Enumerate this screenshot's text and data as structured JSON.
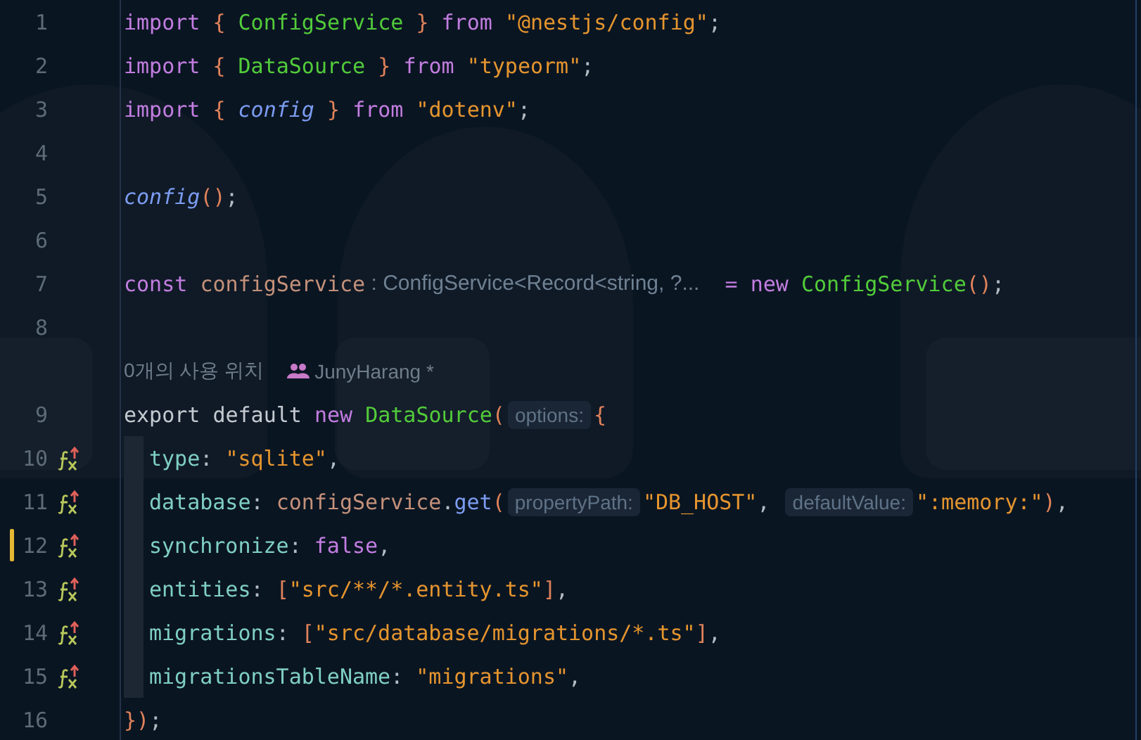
{
  "editor": {
    "lines": [
      {
        "number": "1",
        "modified": false,
        "override_marker": false,
        "indent_guide": false,
        "tokens": [
          {
            "text": "import ",
            "kind": "keyword"
          },
          {
            "text": "{ ",
            "kind": "brace"
          },
          {
            "text": "ConfigService",
            "kind": "class"
          },
          {
            "text": " } ",
            "kind": "brace"
          },
          {
            "text": "from ",
            "kind": "keyword"
          },
          {
            "text": "\"@nestjs/config\"",
            "kind": "string"
          },
          {
            "text": ";",
            "kind": "punct"
          }
        ]
      },
      {
        "number": "2",
        "modified": false,
        "override_marker": false,
        "indent_guide": false,
        "tokens": [
          {
            "text": "import ",
            "kind": "keyword"
          },
          {
            "text": "{ ",
            "kind": "brace"
          },
          {
            "text": "DataSource",
            "kind": "class"
          },
          {
            "text": " } ",
            "kind": "brace"
          },
          {
            "text": "from ",
            "kind": "keyword"
          },
          {
            "text": "\"typeorm\"",
            "kind": "string"
          },
          {
            "text": ";",
            "kind": "punct"
          }
        ]
      },
      {
        "number": "3",
        "modified": false,
        "override_marker": false,
        "indent_guide": false,
        "tokens": [
          {
            "text": "import ",
            "kind": "keyword"
          },
          {
            "text": "{ ",
            "kind": "brace"
          },
          {
            "text": "config",
            "kind": "function"
          },
          {
            "text": " } ",
            "kind": "brace"
          },
          {
            "text": "from ",
            "kind": "keyword"
          },
          {
            "text": "\"dotenv\"",
            "kind": "string"
          },
          {
            "text": ";",
            "kind": "punct"
          }
        ]
      },
      {
        "number": "4",
        "modified": false,
        "override_marker": false,
        "indent_guide": false
      },
      {
        "number": "5",
        "modified": false,
        "override_marker": false,
        "indent_guide": false,
        "tokens": [
          {
            "text": "config",
            "kind": "function"
          },
          {
            "text": "()",
            "kind": "brace"
          },
          {
            "text": ";",
            "kind": "punct"
          }
        ]
      },
      {
        "number": "6",
        "modified": false,
        "override_marker": false,
        "indent_guide": false
      },
      {
        "number": "7",
        "modified": false,
        "override_marker": false,
        "indent_guide": false,
        "tokens": [
          {
            "text": "const ",
            "kind": "keyword"
          },
          {
            "text": "configService",
            "kind": "variable"
          },
          {
            "text": " : ConfigService<Record<string, ?...",
            "kind": "type_hint"
          },
          {
            "text": "  = ",
            "kind": "keyword"
          },
          {
            "text": "new ",
            "kind": "keyword"
          },
          {
            "text": "ConfigService",
            "kind": "class"
          },
          {
            "text": "()",
            "kind": "brace"
          },
          {
            "text": ";",
            "kind": "punct"
          }
        ]
      },
      {
        "number": "8",
        "modified": false,
        "override_marker": false,
        "indent_guide": false,
        "code_lens": {
          "usages": "0개의 사용 위치",
          "author": "JunyHarang *"
        }
      },
      {
        "number": "9",
        "modified": false,
        "override_marker": false,
        "indent_guide": false,
        "tokens": [
          {
            "text": "export default ",
            "kind": "plain"
          },
          {
            "text": "new ",
            "kind": "keyword"
          },
          {
            "text": "DataSource",
            "kind": "class"
          },
          {
            "text": "(",
            "kind": "brace"
          },
          {
            "text": "options:",
            "kind": "hint"
          },
          {
            "text": "{",
            "kind": "brace"
          }
        ]
      },
      {
        "number": "10",
        "modified": false,
        "override_marker": true,
        "indent_guide": true,
        "tokens": [
          {
            "text": "type",
            "kind": "property"
          },
          {
            "text": ": ",
            "kind": "punct"
          },
          {
            "text": "\"sqlite\"",
            "kind": "string"
          },
          {
            "text": ",",
            "kind": "punct"
          }
        ]
      },
      {
        "number": "11",
        "modified": false,
        "override_marker": true,
        "indent_guide": true,
        "tokens": [
          {
            "text": "database",
            "kind": "property"
          },
          {
            "text": ": ",
            "kind": "punct"
          },
          {
            "text": "configService",
            "kind": "variable"
          },
          {
            "text": ".",
            "kind": "punct"
          },
          {
            "text": "get",
            "kind": "method"
          },
          {
            "text": "(",
            "kind": "brace"
          },
          {
            "text": "propertyPath:",
            "kind": "hint"
          },
          {
            "text": "\"DB_HOST\"",
            "kind": "string"
          },
          {
            "text": ", ",
            "kind": "punct"
          },
          {
            "text": "defaultValue:",
            "kind": "hint"
          },
          {
            "text": "\":memory:\"",
            "kind": "string"
          },
          {
            "text": ")",
            "kind": "brace"
          },
          {
            "text": ",",
            "kind": "punct"
          }
        ]
      },
      {
        "number": "12",
        "modified": true,
        "override_marker": true,
        "indent_guide": true,
        "tokens": [
          {
            "text": "synchronize",
            "kind": "property"
          },
          {
            "text": ": ",
            "kind": "punct"
          },
          {
            "text": "false",
            "kind": "keyword"
          },
          {
            "text": ",",
            "kind": "punct"
          }
        ]
      },
      {
        "number": "13",
        "modified": false,
        "override_marker": true,
        "indent_guide": true,
        "tokens": [
          {
            "text": "entities",
            "kind": "property"
          },
          {
            "text": ": ",
            "kind": "punct"
          },
          {
            "text": "[",
            "kind": "brace"
          },
          {
            "text": "\"src/**/*.entity.ts\"",
            "kind": "string"
          },
          {
            "text": "]",
            "kind": "brace"
          },
          {
            "text": ",",
            "kind": "punct"
          }
        ]
      },
      {
        "number": "14",
        "modified": false,
        "override_marker": true,
        "indent_guide": true,
        "tokens": [
          {
            "text": "migrations",
            "kind": "property"
          },
          {
            "text": ": ",
            "kind": "punct"
          },
          {
            "text": "[",
            "kind": "brace"
          },
          {
            "text": "\"src/database/migrations/*.ts\"",
            "kind": "string"
          },
          {
            "text": "]",
            "kind": "brace"
          },
          {
            "text": ",",
            "kind": "punct"
          }
        ]
      },
      {
        "number": "15",
        "modified": false,
        "override_marker": true,
        "indent_guide": true,
        "tokens": [
          {
            "text": "migrationsTableName",
            "kind": "property"
          },
          {
            "text": ": ",
            "kind": "punct"
          },
          {
            "text": "\"migrations\"",
            "kind": "string"
          },
          {
            "text": ",",
            "kind": "punct"
          }
        ]
      },
      {
        "number": "16",
        "modified": false,
        "override_marker": false,
        "indent_guide": false,
        "tokens": [
          {
            "text": "})",
            "kind": "brace"
          },
          {
            "text": ";",
            "kind": "punct"
          }
        ]
      }
    ]
  }
}
